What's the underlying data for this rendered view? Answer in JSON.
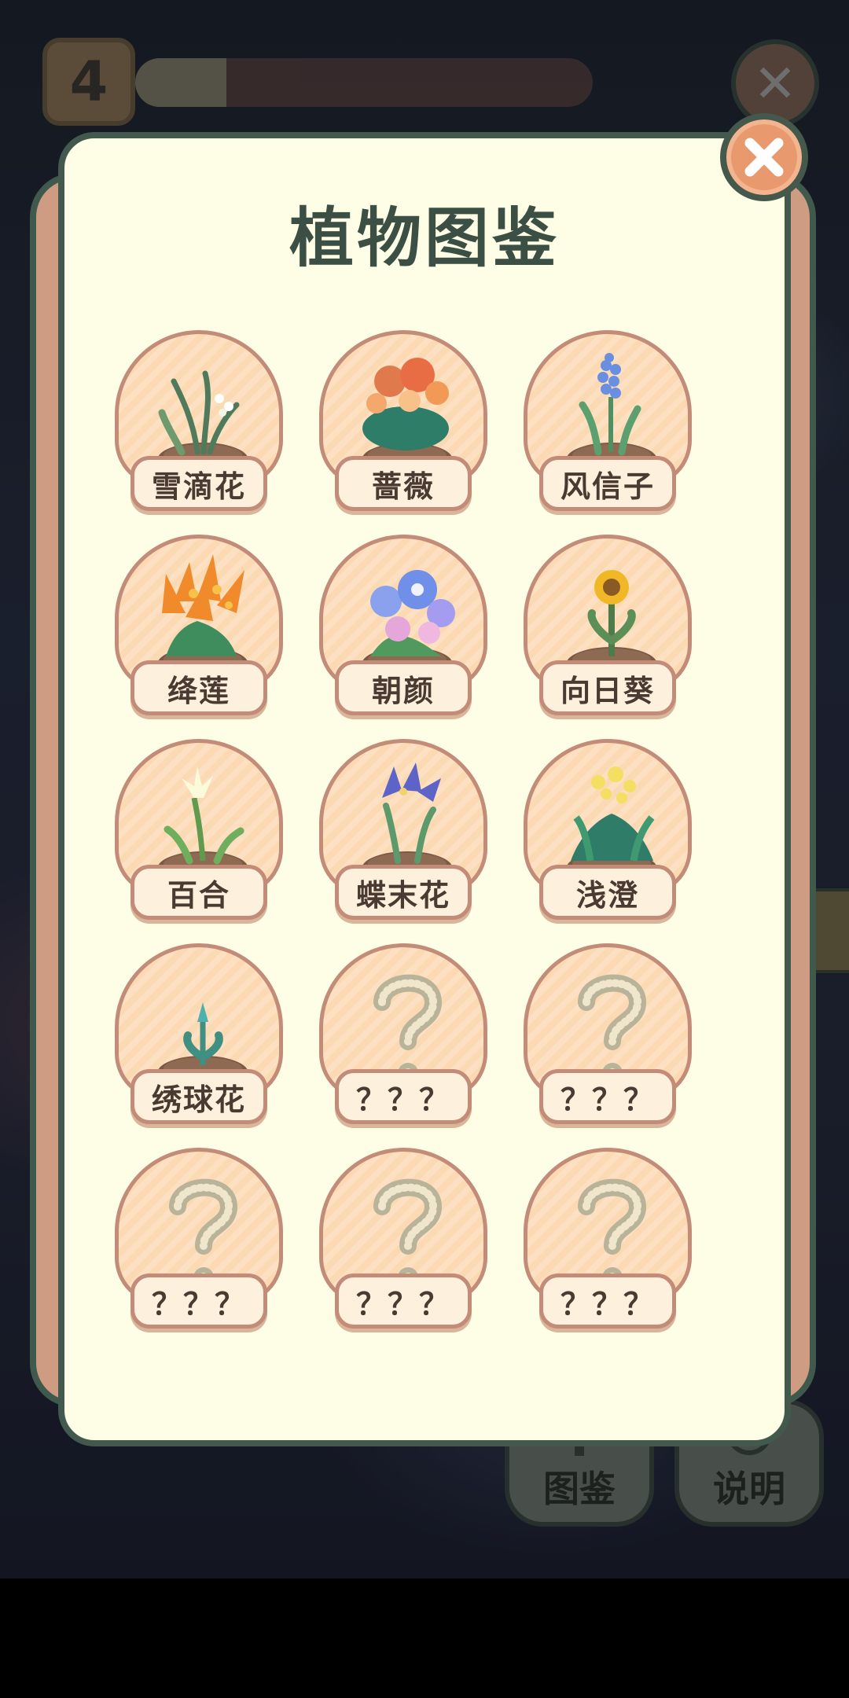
{
  "hud": {
    "level": "4",
    "progress_fraction": 0.2
  },
  "bottom_buttons": [
    {
      "label": "图鉴"
    },
    {
      "label": "说明"
    }
  ],
  "modal": {
    "title": "植物图鉴",
    "close_icon": "close-icon"
  },
  "plants": [
    {
      "name": "雪滴花",
      "unlocked": true,
      "icon": "snowdrop"
    },
    {
      "name": "蔷薇",
      "unlocked": true,
      "icon": "rose"
    },
    {
      "name": "风信子",
      "unlocked": true,
      "icon": "hyacinth"
    },
    {
      "name": "绛莲",
      "unlocked": true,
      "icon": "red-lotus"
    },
    {
      "name": "朝颜",
      "unlocked": true,
      "icon": "morning-glory"
    },
    {
      "name": "向日葵",
      "unlocked": true,
      "icon": "sunflower"
    },
    {
      "name": "百合",
      "unlocked": true,
      "icon": "lily"
    },
    {
      "name": "蝶末花",
      "unlocked": true,
      "icon": "iris"
    },
    {
      "name": "浅澄",
      "unlocked": true,
      "icon": "yellow-flower"
    },
    {
      "name": "绣球花",
      "unlocked": true,
      "icon": "hydrangea-sprout"
    },
    {
      "name": "？？？",
      "unlocked": false,
      "icon": "question-mark"
    },
    {
      "name": "？？？",
      "unlocked": false,
      "icon": "question-mark"
    },
    {
      "name": "？？？",
      "unlocked": false,
      "icon": "question-mark"
    },
    {
      "name": "？？？",
      "unlocked": false,
      "icon": "question-mark"
    },
    {
      "name": "？？？",
      "unlocked": false,
      "icon": "question-mark"
    }
  ]
}
